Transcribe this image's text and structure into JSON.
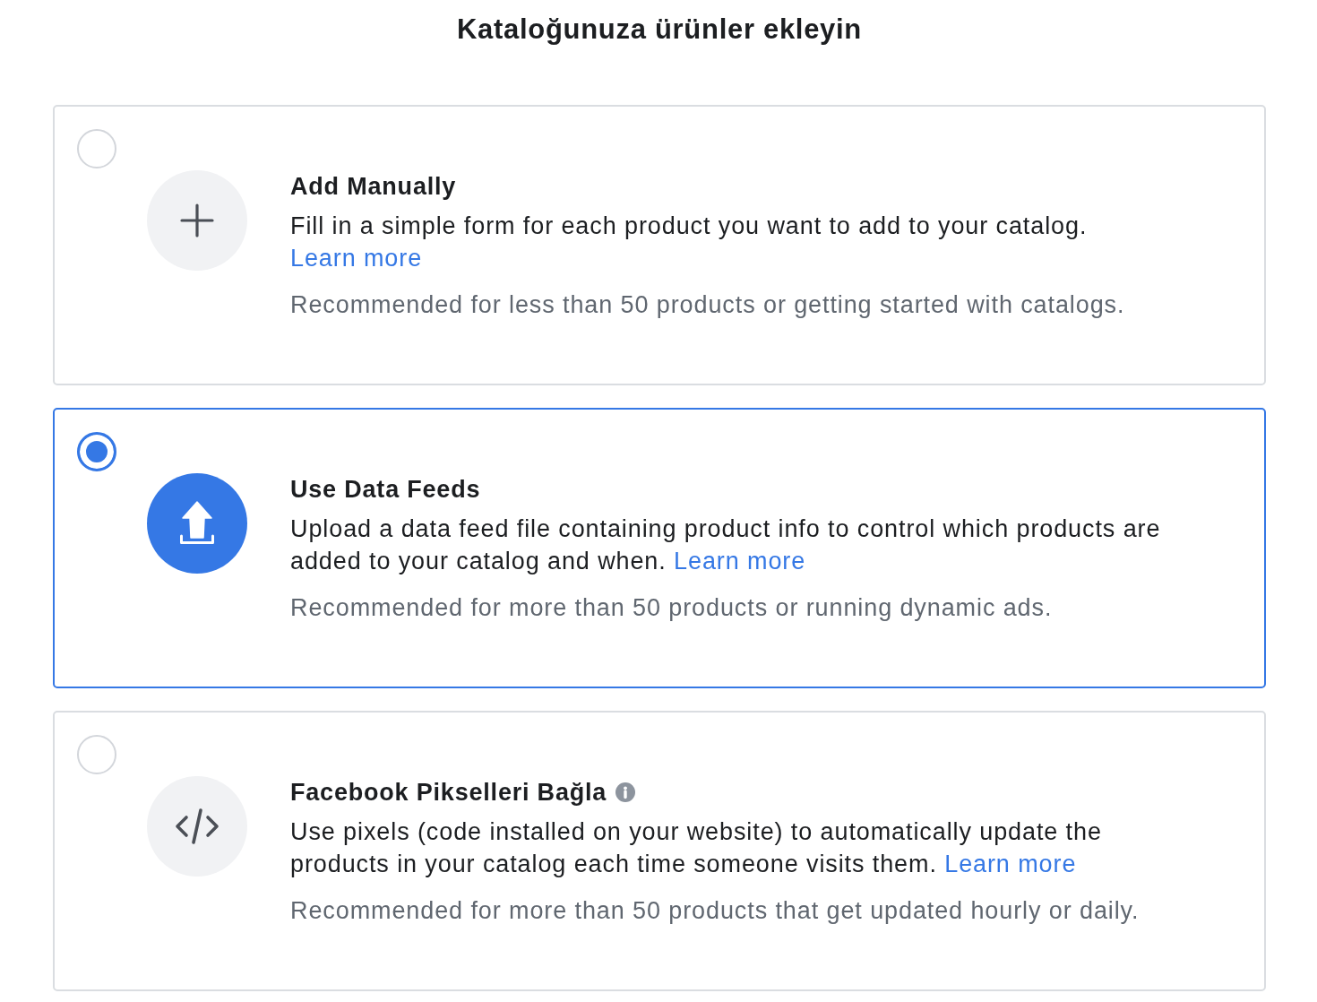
{
  "title": "Kataloğunuza ürünler ekleyin",
  "options": [
    {
      "kind": "manual",
      "selected": false,
      "title": "Add Manually",
      "description": "Fill in a simple form for each product you want to add to your catalog.",
      "link": "Learn more",
      "note": "Recommended for less than 50 products or getting started with catalogs."
    },
    {
      "kind": "feed",
      "selected": true,
      "title": "Use Data Feeds",
      "description": "Upload a data feed file containing product info to control which products are added to your catalog and when.",
      "link": "Learn more",
      "note": "Recommended for more than 50 products or running dynamic ads."
    },
    {
      "kind": "pixel",
      "selected": false,
      "title": "Facebook Pikselleri Bağla",
      "info": true,
      "description": "Use pixels (code installed on your website) to automatically update the products in your catalog each time someone visits them.",
      "link": "Learn more",
      "note": "Recommended for more than 50 products that get updated hourly or daily."
    }
  ]
}
